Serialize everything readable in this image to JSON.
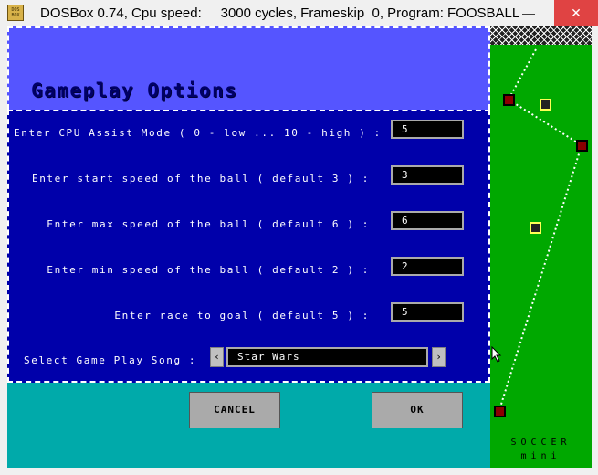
{
  "window": {
    "title": "DOSBox 0.74, Cpu speed:     3000 cycles, Frameskip  0, Program: FOOSBALL",
    "icon_text": "DOS\nBOX",
    "minimize_glyph": "—",
    "close_glyph": "✕"
  },
  "dialog": {
    "title": "Gameplay Options",
    "fields": [
      {
        "label": "Enter CPU Assist Mode ( 0 - low ... 10 - high ) :",
        "value": "5"
      },
      {
        "label": "Enter start speed of the ball ( default 3 ) :",
        "value": "3"
      },
      {
        "label": "Enter max speed of the ball ( default 6 ) :",
        "value": "6"
      },
      {
        "label": "Enter min speed of the ball ( default 2 ) :",
        "value": "2"
      },
      {
        "label": "Enter race to goal ( default 5 ) :",
        "value": "5"
      }
    ],
    "song": {
      "label": "Select Game Play Song :",
      "value": "Star Wars",
      "prev_glyph": "‹",
      "next_glyph": "›"
    },
    "buttons": {
      "cancel": "CANCEL",
      "ok": "OK"
    }
  },
  "mini_field": {
    "label_line1": "SOCCER",
    "label_line2": "mini",
    "colors": {
      "grass": "#00a800",
      "player_red": "#8b0000",
      "player_yellow": "#ffff55"
    }
  }
}
